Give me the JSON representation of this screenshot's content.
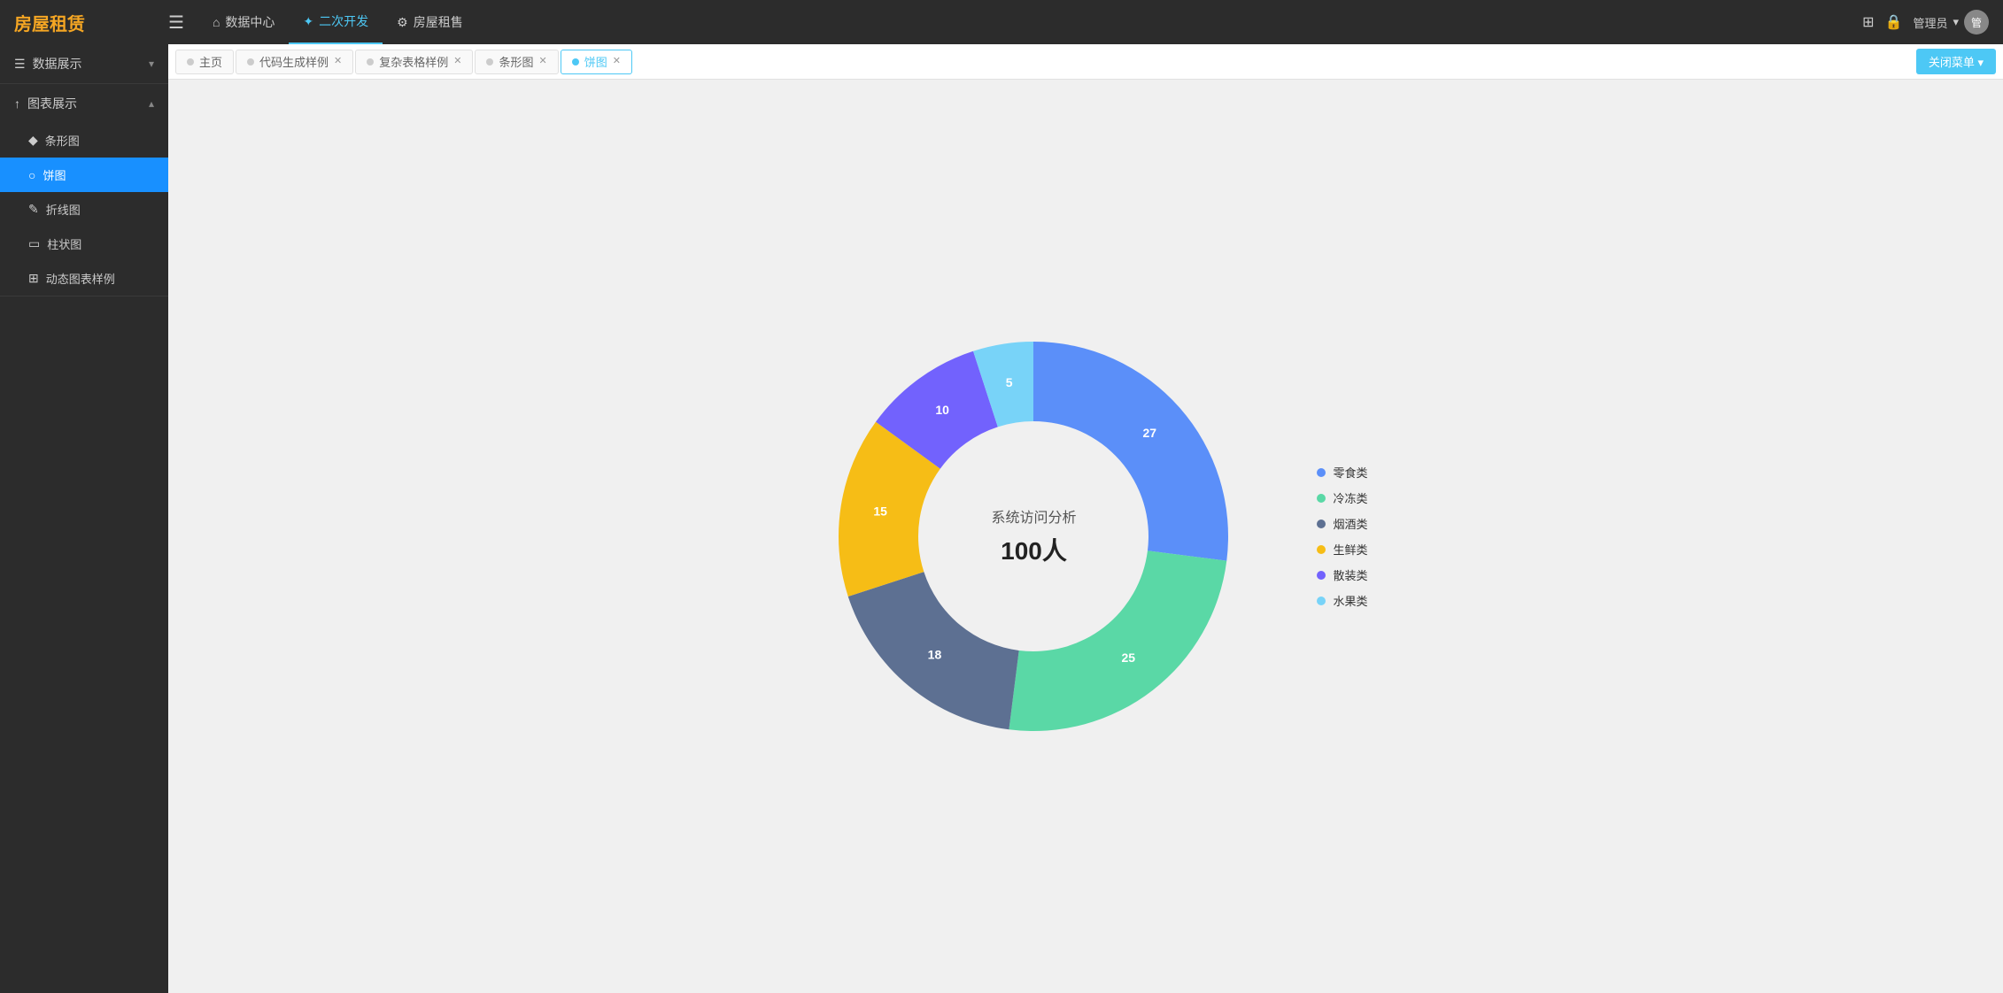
{
  "app": {
    "logo": "房屋租赁",
    "hamburger_icon": "☰"
  },
  "header": {
    "nav_items": [
      {
        "id": "data-center",
        "icon": "⌂",
        "label": "数据中心",
        "active": false
      },
      {
        "id": "second-dev",
        "icon": "✦",
        "label": "二次开发",
        "active": true
      },
      {
        "id": "house-rental",
        "icon": "⚙",
        "label": "房屋租售",
        "active": false
      }
    ],
    "icons": {
      "grid": "⊞",
      "lock": "🔒"
    },
    "user": {
      "name": "管理员",
      "dropdown_icon": "▾"
    },
    "close_menu_label": "关闭菜单 ▾"
  },
  "page_tabs": [
    {
      "id": "home",
      "label": "主页",
      "closable": false,
      "active": false,
      "dot_color": "#ccc"
    },
    {
      "id": "code-gen",
      "label": "代码生成样例",
      "closable": true,
      "active": false,
      "dot_color": "#ccc"
    },
    {
      "id": "complex-table",
      "label": "复杂表格样例",
      "closable": true,
      "active": false,
      "dot_color": "#ccc"
    },
    {
      "id": "bar-chart",
      "label": "条形图",
      "closable": true,
      "active": false,
      "dot_color": "#ccc"
    },
    {
      "id": "pie-chart",
      "label": "饼图",
      "closable": true,
      "active": true,
      "dot_color": "#4dc8f5"
    }
  ],
  "sidebar": {
    "groups": [
      {
        "id": "data-display",
        "icon": "☰",
        "label": "数据展示",
        "expanded": false,
        "arrow": "▾",
        "items": []
      },
      {
        "id": "chart-display",
        "icon": "↑",
        "label": "图表展示",
        "expanded": true,
        "arrow": "▴",
        "items": [
          {
            "id": "bar",
            "icon": "◆",
            "label": "条形图",
            "active": false
          },
          {
            "id": "pie",
            "icon": "○",
            "label": "饼图",
            "active": true
          },
          {
            "id": "line",
            "icon": "✎",
            "label": "折线图",
            "active": false
          },
          {
            "id": "column",
            "icon": "▭",
            "label": "柱状图",
            "active": false
          },
          {
            "id": "dynamic",
            "icon": "⊞",
            "label": "动态图表样例",
            "active": false
          }
        ]
      }
    ]
  },
  "chart": {
    "title": "系统访问分析",
    "total_label": "100人",
    "segments": [
      {
        "id": "snack",
        "label": "零食类",
        "value": 27,
        "color": "#5b8ff9",
        "start_angle": 0,
        "end_angle": 97.2
      },
      {
        "id": "frozen",
        "label": "冷冻类",
        "value": 25,
        "color": "#5ad8a6",
        "start_angle": 97.2,
        "end_angle": 187.2
      },
      {
        "id": "tobacco",
        "label": "烟酒类",
        "value": 18,
        "color": "#5d7092",
        "start_angle": 187.2,
        "end_angle": 252.0
      },
      {
        "id": "fresh",
        "label": "生鲜类",
        "value": 15,
        "color": "#f6bd16",
        "start_angle": 252.0,
        "end_angle": 306.0
      },
      {
        "id": "bulk",
        "label": "散装类",
        "value": 10,
        "color": "#7262fd",
        "start_angle": 306.0,
        "end_angle": 342.0
      },
      {
        "id": "fruit",
        "label": "水果类",
        "value": 5,
        "color": "#78d3f8",
        "start_angle": 342.0,
        "end_angle": 360.0
      }
    ]
  }
}
